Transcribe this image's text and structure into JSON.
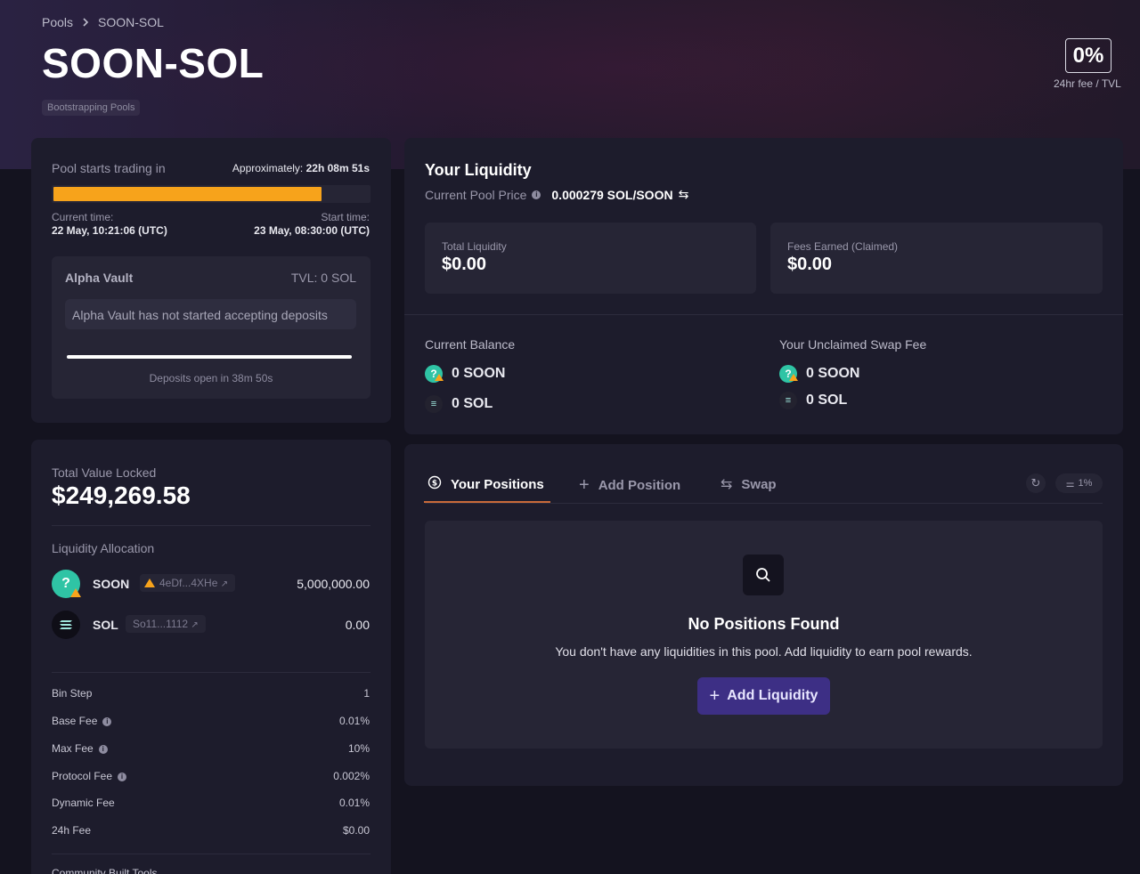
{
  "breadcrumb": {
    "root": "Pools",
    "separator": "›",
    "current": "SOON-SOL"
  },
  "header": {
    "title": "SOON-SOL",
    "tag": "Bootstrapping Pools",
    "fee_value": "0%",
    "fee_label": "24hr fee / TVL"
  },
  "trading": {
    "label": "Pool starts trading in",
    "approx_label": "Approximately:",
    "approx_value": "22h 08m 51s",
    "progress_fraction": 0.85,
    "current_time_label": "Current time:",
    "current_time": "22 May, 10:21:06 (UTC)",
    "start_time_label": "Start time:",
    "start_time": "23 May, 08:30:00 (UTC)"
  },
  "alpha_vault": {
    "title": "Alpha Vault",
    "tvl": "TVL: 0 SOL",
    "message": "Alpha Vault has not started accepting deposits",
    "progress_fraction": 1.0,
    "deposits_open": "Deposits open in 38m 50s"
  },
  "tvl": {
    "label": "Total Value Locked",
    "value": "$249,269.58",
    "allocation_label": "Liquidity Allocation",
    "tokens": [
      {
        "symbol": "SOON",
        "address": "4eDf...4XHe",
        "amount": "5,000,000.00",
        "icon": "question-mark-coin"
      },
      {
        "symbol": "SOL",
        "address": "So11...1112",
        "amount": "0.00",
        "icon": "solana-coin"
      }
    ]
  },
  "params": [
    {
      "label": "Bin Step",
      "value": "1",
      "info": false
    },
    {
      "label": "Base Fee",
      "value": "0.01%",
      "info": true
    },
    {
      "label": "Max Fee",
      "value": "10%",
      "info": true
    },
    {
      "label": "Protocol Fee",
      "value": "0.002%",
      "info": true
    },
    {
      "label": "Dynamic Fee",
      "value": "0.01%",
      "info": false
    },
    {
      "label": "24h Fee",
      "value": "$0.00",
      "info": false
    }
  ],
  "community_tools": "Community Built Tools",
  "liquidity": {
    "title": "Your Liquidity",
    "price_label": "Current Pool Price",
    "price_value": "0.000279 SOL/SOON",
    "total_label": "Total Liquidity",
    "total_value": "$0.00",
    "fees_label": "Fees Earned (Claimed)",
    "fees_value": "$0.00",
    "balance_label": "Current Balance",
    "balance": [
      "0 SOON",
      "0 SOL"
    ],
    "unclaimed_label": "Your Unclaimed Swap Fee",
    "unclaimed": [
      "0 SOON",
      "0 SOL"
    ]
  },
  "positions": {
    "tabs": [
      "Your Positions",
      "Add Position",
      "Swap"
    ],
    "slippage": "1%",
    "empty_title": "No Positions Found",
    "empty_text": "You don't have any liquidities in this pool. Add liquidity to earn pool rewards.",
    "add_button": "Add Liquidity"
  },
  "colors": {
    "accent": "#f7a31b",
    "button": "#3d2f85",
    "tab_underline": "#c96a3a"
  }
}
